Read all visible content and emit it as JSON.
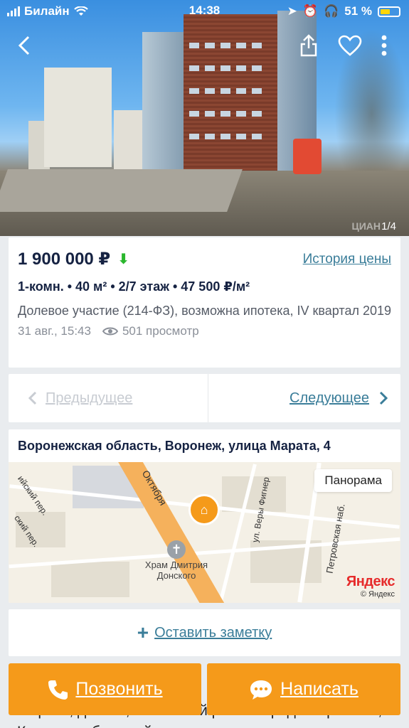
{
  "status_bar": {
    "carrier": "Билайн",
    "time": "14:38",
    "battery": "51 %"
  },
  "photo": {
    "counter": "1/4",
    "watermark": "ЦИАН"
  },
  "listing": {
    "price": "1 900 000 ₽",
    "price_history_link": "История цены",
    "params": "1-комн. • 40 м² • 2/7 этаж • 47 500 ₽/м²",
    "description": "Долевое участие (214-ФЗ), возможна ипотека, IV квартал 2019",
    "date": "31 авг., 15:43",
    "views": "501 просмотр"
  },
  "navigation": {
    "prev_label": "Предыдущее",
    "next_label": "Следующее"
  },
  "address": {
    "text": "Воронежская область, Воронеж, улица Марата, 4",
    "panorama_button": "Панорама",
    "map_labels": {
      "main_road": "Октября",
      "street_vera": "ул. Веры Фигнер",
      "street_petrov": "Петровская наб.",
      "church": "Храм Дмитрия Донского",
      "left_street": "ийский пер.",
      "left_street2": "ский пер."
    },
    "yandex_logo": "Яндекс",
    "yandex_copy": "© Яндекс"
  },
  "note": {
    "label": "Оставить заметку"
  },
  "background_text": "Марата, дом 2а, Ленинский район города Воронежа, Корпус глобальный",
  "actions": {
    "call_label": "Позвонить",
    "message_label": "Написать"
  },
  "colors": {
    "accent_orange": "#f59a1a",
    "link_blue": "#3a7d99",
    "price_down_green": "#2ab72d"
  }
}
